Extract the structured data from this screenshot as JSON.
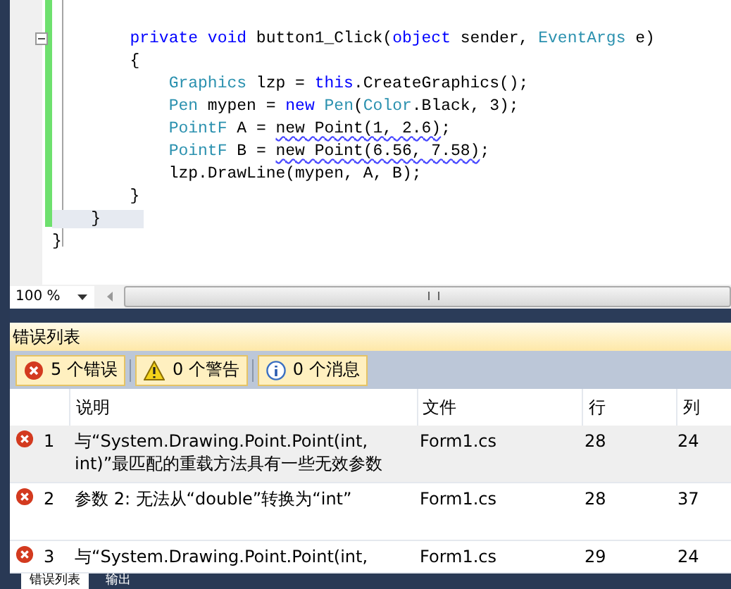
{
  "editor": {
    "lines": [
      {
        "tokens": [
          {
            "text": "        private void",
            "kind": "keyword"
          },
          {
            "text": " button1_Click(",
            "kind": "plain"
          },
          {
            "text": "object",
            "kind": "keyword"
          },
          {
            "text": " sender, ",
            "kind": "plain"
          },
          {
            "text": "EventArgs",
            "kind": "type"
          },
          {
            "text": " e)",
            "kind": "plain"
          }
        ],
        "highlight": false,
        "collapse": true
      },
      {
        "tokens": [
          {
            "text": "        {",
            "kind": "plain"
          }
        ],
        "highlight": false,
        "collapse": false
      },
      {
        "tokens": [
          {
            "text": "            Graphics",
            "kind": "type"
          },
          {
            "text": " lzp = ",
            "kind": "plain"
          },
          {
            "text": "this",
            "kind": "keyword"
          },
          {
            "text": ".CreateGraphics();",
            "kind": "plain"
          }
        ],
        "highlight": false,
        "collapse": false
      },
      {
        "tokens": [
          {
            "text": "            Pen",
            "kind": "type"
          },
          {
            "text": " mypen = ",
            "kind": "plain"
          },
          {
            "text": "new ",
            "kind": "keyword"
          },
          {
            "text": "Pen",
            "kind": "type"
          },
          {
            "text": "(",
            "kind": "plain"
          },
          {
            "text": "Color",
            "kind": "type"
          },
          {
            "text": ".Black, 3);",
            "kind": "plain"
          }
        ],
        "highlight": false,
        "collapse": false
      },
      {
        "tokens": [
          {
            "text": "            PointF",
            "kind": "type"
          },
          {
            "text": " A = ",
            "kind": "plain"
          },
          {
            "text": "new Point(1, 2.6)",
            "kind": "error"
          },
          {
            "text": ";",
            "kind": "plain"
          }
        ],
        "highlight": false,
        "collapse": false
      },
      {
        "tokens": [
          {
            "text": "            PointF",
            "kind": "type"
          },
          {
            "text": " B = ",
            "kind": "plain"
          },
          {
            "text": "new Point(6.56, 7.58)",
            "kind": "error"
          },
          {
            "text": ";",
            "kind": "plain"
          }
        ],
        "highlight": false,
        "collapse": false
      },
      {
        "tokens": [
          {
            "text": "            lzp.DrawLine(mypen, A, B);",
            "kind": "plain"
          }
        ],
        "highlight": false,
        "collapse": false
      },
      {
        "tokens": [
          {
            "text": "        }",
            "kind": "plain"
          }
        ],
        "highlight": false,
        "collapse": false
      },
      {
        "tokens": [
          {
            "text": "    }",
            "kind": "plain"
          }
        ],
        "highlight": true,
        "collapse": false
      },
      {
        "tokens": [
          {
            "text": "}",
            "kind": "plain"
          }
        ],
        "highlight": false,
        "collapse": false
      }
    ],
    "zoom": "100 %"
  },
  "error_list": {
    "title": "错误列表",
    "filters": [
      {
        "kind": "error",
        "label": "5 个错误",
        "on": true
      },
      {
        "kind": "warning",
        "label": "0 个警告",
        "on": true
      },
      {
        "kind": "info",
        "label": "0 个消息",
        "on": true
      }
    ],
    "columns": [
      "说明",
      "文件",
      "行",
      "列"
    ],
    "rows": [
      {
        "kind": "error",
        "index": "1",
        "description": "与“System.Drawing.Point.Point(int, int)”最匹配的重载方法具有一些无效参数",
        "file": "Form1.cs",
        "line": "28",
        "column": "24",
        "selected": true
      },
      {
        "kind": "error",
        "index": "2",
        "description": "参数 2: 无法从“double”转换为“int”",
        "file": "Form1.cs",
        "line": "28",
        "column": "37",
        "selected": false
      },
      {
        "kind": "error",
        "index": "3",
        "description": "与“System.Drawing.Point.Point(int,",
        "file": "Form1.cs",
        "line": "29",
        "column": "24",
        "selected": false
      }
    ]
  },
  "bottom_tabs": [
    {
      "label": "错误列表",
      "selected": true
    },
    {
      "label": "输出",
      "selected": false
    }
  ]
}
